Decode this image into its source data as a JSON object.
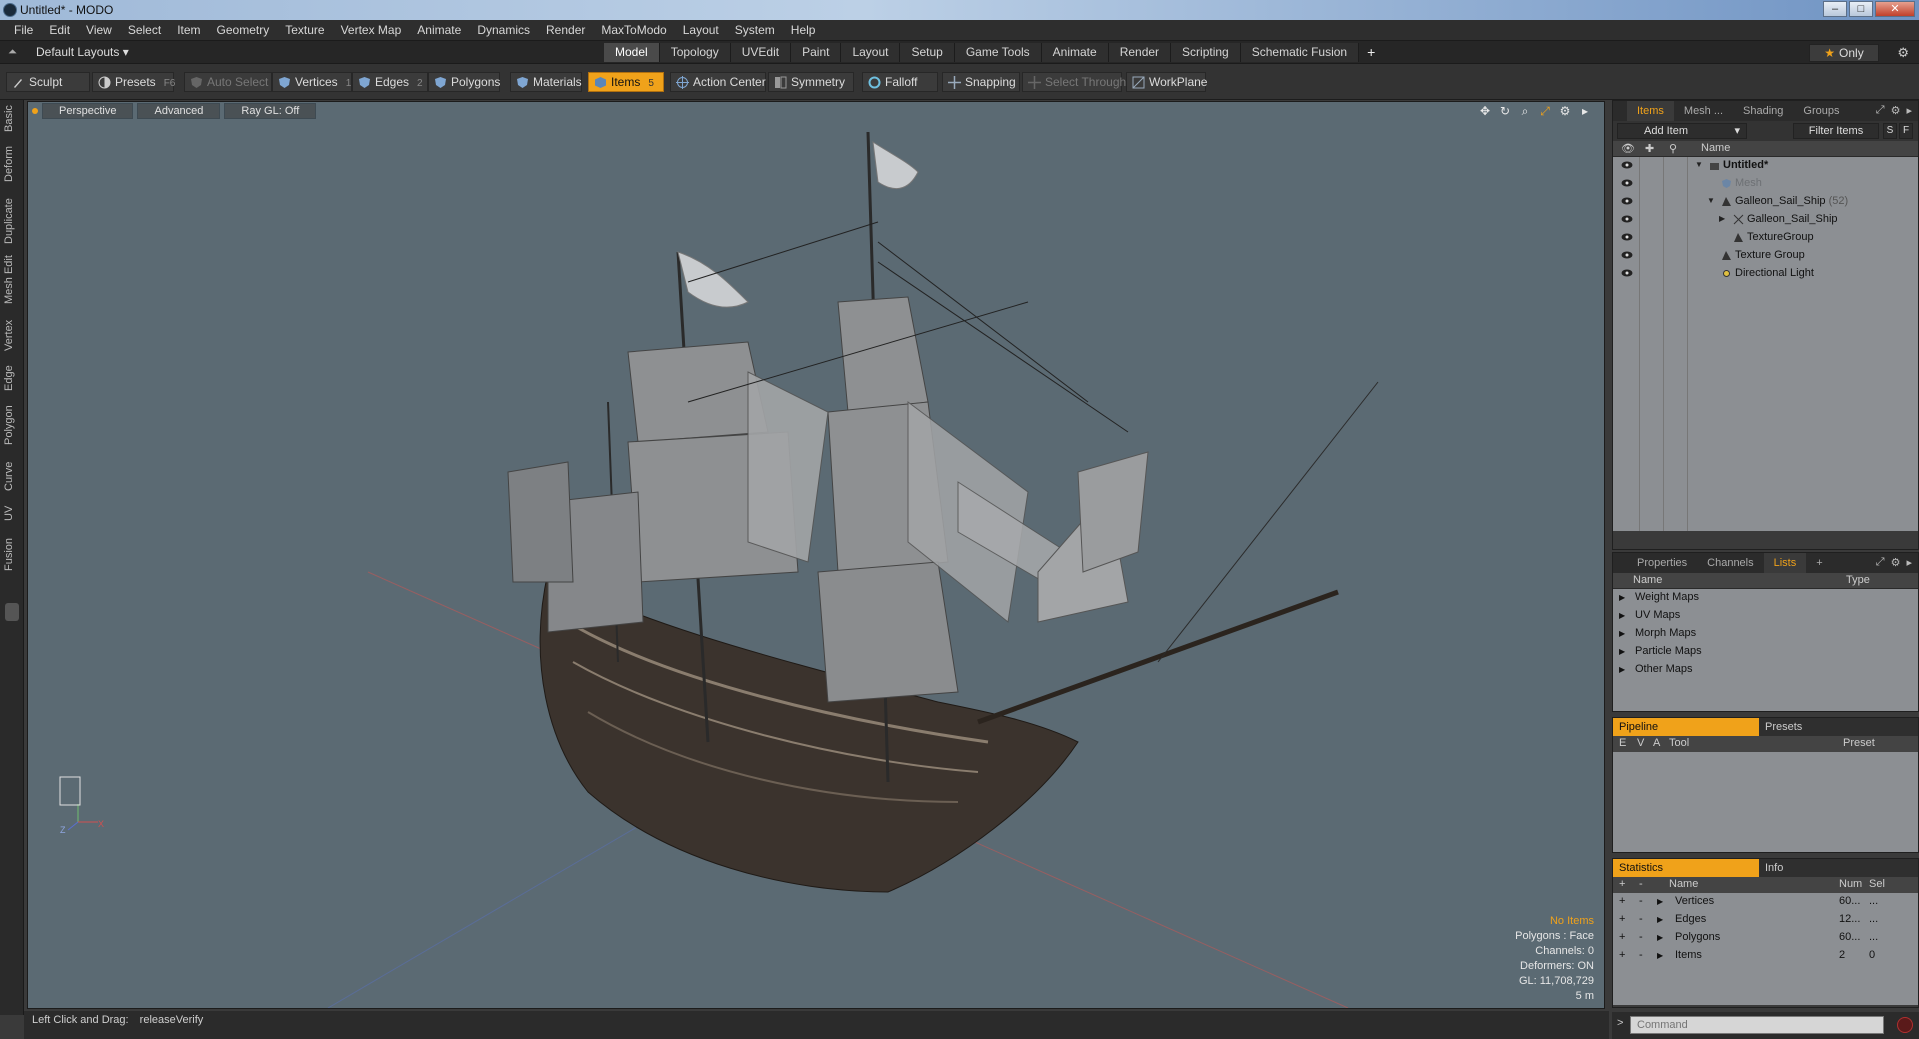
{
  "window": {
    "title": "Untitled* - MODO"
  },
  "menu": [
    "File",
    "Edit",
    "View",
    "Select",
    "Item",
    "Geometry",
    "Texture",
    "Vertex Map",
    "Animate",
    "Dynamics",
    "Render",
    "MaxToModo",
    "Layout",
    "System",
    "Help"
  ],
  "layout": {
    "selector": "Default Layouts ▾",
    "tabs": [
      "Model",
      "Topology",
      "UVEdit",
      "Paint",
      "Layout",
      "Setup",
      "Game Tools",
      "Animate",
      "Render",
      "Scripting",
      "Schematic Fusion"
    ],
    "active_tab": "Model",
    "add_tab": "+",
    "only_label": "Only"
  },
  "toolbar": {
    "sculpt": "Sculpt",
    "presets": "Presets",
    "presets_key": "F6",
    "auto_select": "Auto Select",
    "vertices": "Vertices",
    "vertices_key": "1",
    "edges": "Edges",
    "edges_key": "2",
    "polygons": "Polygons",
    "materials": "Materials",
    "items": "Items",
    "items_key": "5",
    "action_center": "Action Center",
    "symmetry": "Symmetry",
    "falloff": "Falloff",
    "snapping": "Snapping",
    "select_through": "Select Through",
    "workplane": "WorkPlane"
  },
  "left_tabs": [
    "Basic",
    "Deform",
    "Duplicate",
    "Mesh Edit",
    "Vertex",
    "Edge",
    "Polygon",
    "Curve",
    "UV",
    "Fusion"
  ],
  "viewport": {
    "view": "Perspective",
    "shading": "Advanced",
    "raygl": "Ray GL: Off",
    "stats": {
      "no_items": "No Items",
      "polygons": "Polygons : Face",
      "channels": "Channels: 0",
      "deformers": "Deformers: ON",
      "gl": "GL: 11,708,729",
      "scale": "5 m"
    },
    "axis_x": "X",
    "axis_z": "Z"
  },
  "status": {
    "hint": "Left Click and Drag:",
    "action": "releaseVerify"
  },
  "items_panel": {
    "tabs": [
      "Items",
      "Mesh ...",
      "Shading",
      "Groups"
    ],
    "add_item": "Add Item",
    "filter": "Filter Items",
    "s": "S",
    "f": "F",
    "name_header": "Name",
    "tree": [
      {
        "label": "Untitled*",
        "count": ""
      },
      {
        "label": "Mesh",
        "count": ""
      },
      {
        "label": "Galleon_Sail_Ship",
        "count": "(52)"
      },
      {
        "label": "Galleon_Sail_Ship",
        "count": ""
      },
      {
        "label": "TextureGroup",
        "count": ""
      },
      {
        "label": "Texture Group",
        "count": ""
      },
      {
        "label": "Directional Light",
        "count": ""
      }
    ]
  },
  "props_panel": {
    "tabs": [
      "Properties",
      "Channels",
      "Lists"
    ],
    "add": "+",
    "name_header": "Name",
    "type_header": "Type",
    "lists": [
      "Weight Maps",
      "UV Maps",
      "Morph Maps",
      "Particle Maps",
      "Other Maps"
    ]
  },
  "pipeline_panel": {
    "tabs": [
      "Pipeline",
      "Presets"
    ],
    "headers": {
      "e": "E",
      "v": "V",
      "a": "A",
      "tool": "Tool",
      "preset": "Preset"
    }
  },
  "stats_panel": {
    "tabs": [
      "Statistics",
      "Info"
    ],
    "headers": {
      "plus": "+",
      "minus": "-",
      "name": "Name",
      "num": "Num",
      "sel": "Sel"
    },
    "rows": [
      {
        "plus": "+",
        "minus": "-",
        "name": "Vertices",
        "num": "60...",
        "sel": "..."
      },
      {
        "plus": "+",
        "minus": "-",
        "name": "Edges",
        "num": "12...",
        "sel": "..."
      },
      {
        "plus": "+",
        "minus": "-",
        "name": "Polygons",
        "num": "60...",
        "sel": "..."
      },
      {
        "plus": "+",
        "minus": "-",
        "name": "Items",
        "num": "2",
        "sel": "0"
      }
    ]
  },
  "command": {
    "placeholder": "Command"
  },
  "colors": {
    "accent": "#f0a21a",
    "viewport_bg": "#5b6a73",
    "panel_bg": "#3a3a3a"
  }
}
